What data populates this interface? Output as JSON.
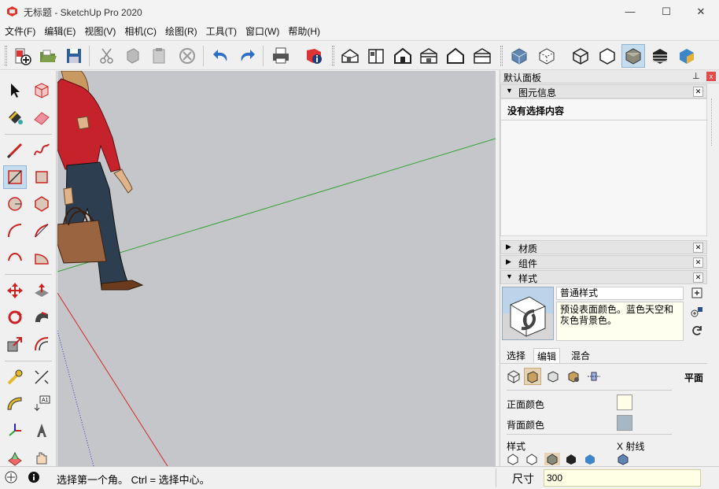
{
  "window": {
    "title": "无标题 - SketchUp Pro 2020",
    "minimize_glyph": "—",
    "maximize_glyph": "☐",
    "close_glyph": "✕"
  },
  "menu": [
    "文件(F)",
    "编辑(E)",
    "视图(V)",
    "相机(C)",
    "绘图(R)",
    "工具(T)",
    "窗口(W)",
    "帮助(H)"
  ],
  "toolbar": {
    "icons": [
      "new-file-icon",
      "open-file-icon",
      "save-icon",
      "cut-icon",
      "copy-icon",
      "paste-icon",
      "erase-icon",
      "undo-icon",
      "redo-icon",
      "print-icon",
      "model-info-icon",
      "iso-view-icon",
      "top-view-icon",
      "front-view-icon",
      "right-view-icon",
      "back-view-icon",
      "left-view-icon",
      "xray-icon",
      "back-edges-icon",
      "wireframe-icon",
      "hidden-line-icon",
      "shaded-icon",
      "shaded-textures-icon",
      "monochrome-icon"
    ]
  },
  "tools": {
    "icons": [
      "select-icon",
      "make-component-icon",
      "paint-bucket-icon",
      "eraser-icon",
      "line-icon",
      "freehand-icon",
      "rectangle-icon",
      "rotated-rectangle-icon",
      "circle-icon",
      "polygon-icon",
      "arc-icon",
      "two-point-arc-icon",
      "three-point-arc-icon",
      "pie-icon",
      "move-icon",
      "push-pull-icon",
      "rotate-icon",
      "follow-me-icon",
      "scale-icon",
      "offset-icon",
      "tape-measure-icon",
      "dimension-icon",
      "protractor-icon",
      "text-icon",
      "axes-icon",
      "3d-text-icon",
      "section-plane-icon",
      "hand-icon"
    ]
  },
  "tray": {
    "title": "默认面板",
    "pin_glyph": "⊥",
    "close_glyph": "x",
    "entity_info": {
      "title": "图元信息",
      "text": "没有选择内容"
    },
    "materials": {
      "title": "材质"
    },
    "components": {
      "title": "组件"
    },
    "styles": {
      "title": "样式",
      "style_name": "普通样式",
      "style_desc": "预设表面颜色。蓝色天空和灰色背景色。",
      "tabs": [
        "选择",
        "编辑",
        "混合"
      ],
      "active_tab": "编辑",
      "edit_mode_label": "平面",
      "front_color_label": "正面颜色",
      "back_color_label": "背面颜色",
      "style_label": "样式",
      "xray_label": "X 射线",
      "front_color": "#fdfde8",
      "back_color": "#a7b7c4"
    }
  },
  "status": {
    "text": "选择第一个角。 Ctrl = 选择中心。",
    "vcb_label": "尺寸",
    "vcb_value": "300"
  },
  "colors": {
    "viewport_bg": "#c4c6ca",
    "green_axis": "#34a234",
    "red_axis": "#d22a2a",
    "blue_axis": "#3838c8",
    "accent": "#c5dcee"
  }
}
